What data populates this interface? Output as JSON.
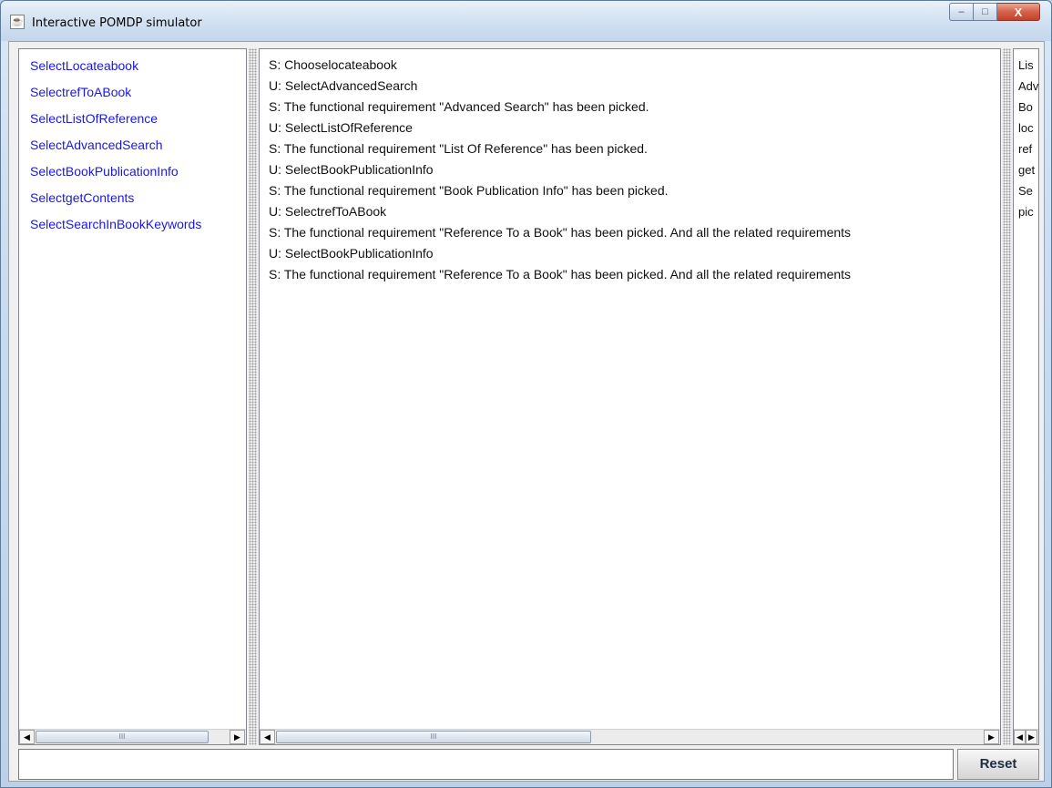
{
  "window": {
    "title": "Interactive POMDP simulator",
    "controls": {
      "minimize": "–",
      "maximize": "□",
      "close": "X"
    }
  },
  "actions": {
    "items": [
      "SelectLocateabook",
      "SelectrefToABook",
      "SelectListOfReference",
      "SelectAdvancedSearch",
      "SelectBookPublicationInfo",
      "SelectgetContents",
      "SelectSearchInBookKeywords"
    ]
  },
  "dialogue": {
    "lines": [
      "S: Chooselocateabook",
      "U: SelectAdvancedSearch",
      "S: The functional requirement \"Advanced Search\" has been picked.",
      "U: SelectListOfReference",
      "S: The functional requirement \"List Of Reference\" has been picked.",
      "U: SelectBookPublicationInfo",
      "S: The functional requirement \"Book Publication Info\" has been picked.",
      "U: SelectrefToABook",
      "S: The functional requirement \"Reference To a Book\" has been picked. And all the related requirements",
      "U: SelectBookPublicationInfo",
      "S: The functional requirement \"Reference To a Book\" has been picked. And all the related requirements"
    ]
  },
  "state": {
    "lines": [
      "Lis",
      "Adv",
      "Bo",
      "loc",
      "ref",
      "get",
      "Se",
      "pic"
    ]
  },
  "bottom": {
    "input_value": "",
    "reset_label": "Reset"
  },
  "scroll": {
    "left_arrow": "◀",
    "right_arrow": "▶",
    "grip": "III"
  }
}
